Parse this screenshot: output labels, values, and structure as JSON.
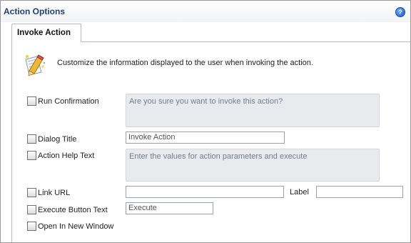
{
  "header": {
    "title": "Action Options",
    "help_icon": "?"
  },
  "tab": {
    "label": "Invoke Action"
  },
  "intro": {
    "text": "Customize the information displayed to the user when invoking the action."
  },
  "options": {
    "run_confirmation": {
      "label": "Run Confirmation",
      "placeholder": "Are you sure you want to invoke this action?"
    },
    "dialog_title": {
      "label": "Dialog Title",
      "value": "Invoke Action"
    },
    "action_help_text": {
      "label": "Action Help Text",
      "placeholder": "Enter the values for action parameters and execute"
    },
    "link_url": {
      "label": "Link URL",
      "value": "",
      "label_field_label": "Label",
      "label_value": ""
    },
    "execute_button_text": {
      "label": "Execute Button Text",
      "value": "Execute"
    },
    "open_in_new_window": {
      "label": "Open In New Window"
    }
  },
  "colors": {
    "header_title": "#1f3f76",
    "field_bg": "#e9eaed",
    "placeholder_text": "#6f7d91"
  },
  "icons": {
    "help": "help-icon",
    "wizard": "wizard-pencil-icon"
  }
}
